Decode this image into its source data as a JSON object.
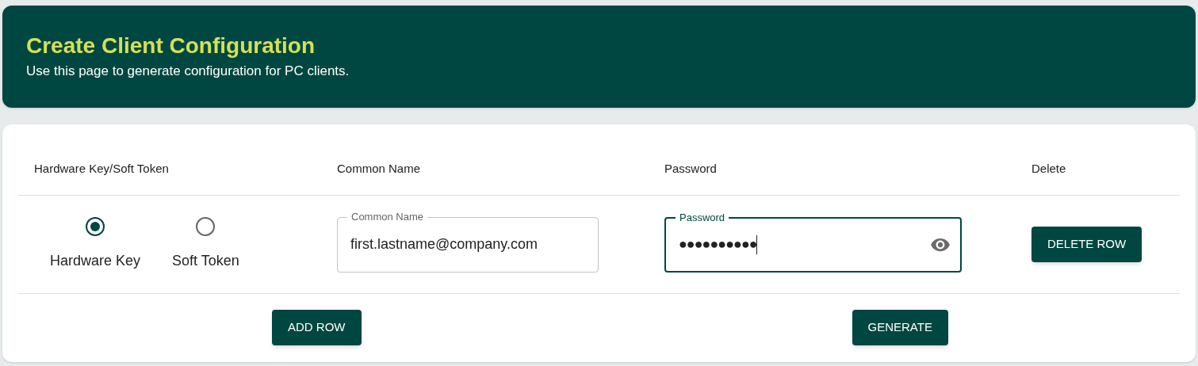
{
  "header": {
    "title": "Create Client Configuration",
    "subtitle": "Use this page to generate configuration for PC clients."
  },
  "table": {
    "columns": [
      "Hardware Key/Soft Token",
      "Common Name",
      "Password",
      "Delete"
    ],
    "rows": [
      {
        "token_options": [
          {
            "label": "Hardware Key",
            "selected": true
          },
          {
            "label": "Soft Token",
            "selected": false
          }
        ],
        "common_name": {
          "label": "Common Name",
          "value": "first.lastname@company.com",
          "focused": false
        },
        "password": {
          "label": "Password",
          "value": "●●●●●●●●●●",
          "focused": true
        },
        "delete_button": "DELETE ROW"
      }
    ]
  },
  "actions": [
    "ADD ROW",
    "GENERATE"
  ]
}
